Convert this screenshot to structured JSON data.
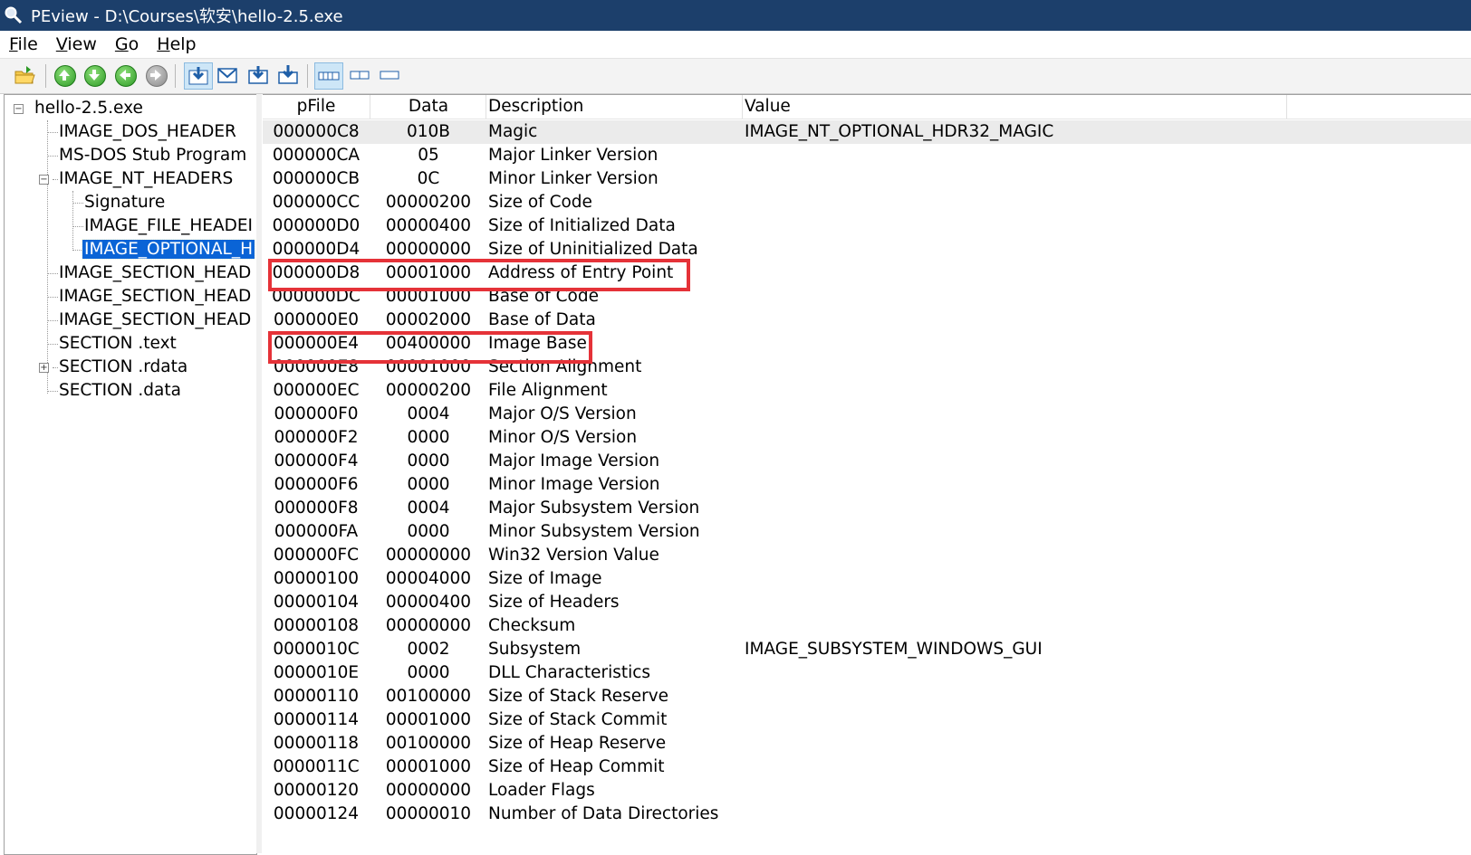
{
  "window": {
    "title": "PEview - D:\\Courses\\软安\\hello-2.5.exe"
  },
  "menu": {
    "items": [
      {
        "first": "F",
        "rest": "ile"
      },
      {
        "first": "V",
        "rest": "iew"
      },
      {
        "first": "G",
        "rest": "o"
      },
      {
        "first": "H",
        "rest": "elp"
      }
    ]
  },
  "toolbar": {
    "icons": [
      "open-folder-icon",
      "up-arrow-icon",
      "down-arrow-icon",
      "back-arrow-icon",
      "forward-arrow-icon",
      "view-download-icon",
      "view-mail-icon",
      "view-export-icon",
      "view-import-icon",
      "layout-full-icon",
      "layout-split-icon",
      "layout-minimal-icon"
    ],
    "accent": "#2c9a25"
  },
  "tree": {
    "root": "hello-2.5.exe",
    "items": [
      "IMAGE_DOS_HEADER",
      "MS-DOS Stub Program",
      "IMAGE_NT_HEADERS",
      "Signature",
      "IMAGE_FILE_HEADEI",
      "IMAGE_OPTIONAL_H",
      "IMAGE_SECTION_HEAD",
      "IMAGE_SECTION_HEAD",
      "IMAGE_SECTION_HEAD",
      "SECTION .text",
      "SECTION .rdata",
      "SECTION .data"
    ],
    "selected_color": "#0a64d6"
  },
  "list": {
    "columns": [
      "pFile",
      "Data",
      "Description",
      "Value"
    ],
    "rows": [
      [
        "000000C8",
        "010B",
        "Magic",
        "IMAGE_NT_OPTIONAL_HDR32_MAGIC"
      ],
      [
        "000000CA",
        "05",
        "Major Linker Version",
        ""
      ],
      [
        "000000CB",
        "0C",
        "Minor Linker Version",
        ""
      ],
      [
        "000000CC",
        "00000200",
        "Size of Code",
        ""
      ],
      [
        "000000D0",
        "00000400",
        "Size of Initialized Data",
        ""
      ],
      [
        "000000D4",
        "00000000",
        "Size of Uninitialized Data",
        ""
      ],
      [
        "000000D8",
        "00001000",
        "Address of Entry Point",
        ""
      ],
      [
        "000000DC",
        "00001000",
        "Base of Code",
        ""
      ],
      [
        "000000E0",
        "00002000",
        "Base of Data",
        ""
      ],
      [
        "000000E4",
        "00400000",
        "Image Base",
        ""
      ],
      [
        "000000E8",
        "00001000",
        "Section Alignment",
        ""
      ],
      [
        "000000EC",
        "00000200",
        "File Alignment",
        ""
      ],
      [
        "000000F0",
        "0004",
        "Major O/S Version",
        ""
      ],
      [
        "000000F2",
        "0000",
        "Minor O/S Version",
        ""
      ],
      [
        "000000F4",
        "0000",
        "Major Image Version",
        ""
      ],
      [
        "000000F6",
        "0000",
        "Minor Image Version",
        ""
      ],
      [
        "000000F8",
        "0004",
        "Major Subsystem Version",
        ""
      ],
      [
        "000000FA",
        "0000",
        "Minor Subsystem Version",
        ""
      ],
      [
        "000000FC",
        "00000000",
        "Win32 Version Value",
        ""
      ],
      [
        "00000100",
        "00004000",
        "Size of Image",
        ""
      ],
      [
        "00000104",
        "00000400",
        "Size of Headers",
        ""
      ],
      [
        "00000108",
        "00000000",
        "Checksum",
        ""
      ],
      [
        "0000010C",
        "0002",
        "Subsystem",
        "IMAGE_SUBSYSTEM_WINDOWS_GUI"
      ],
      [
        "0000010E",
        "0000",
        "DLL Characteristics",
        ""
      ],
      [
        "00000110",
        "00100000",
        "Size of Stack Reserve",
        ""
      ],
      [
        "00000114",
        "00001000",
        "Size of Stack Commit",
        ""
      ],
      [
        "00000118",
        "00100000",
        "Size of Heap Reserve",
        ""
      ],
      [
        "0000011C",
        "00001000",
        "Size of Heap Commit",
        ""
      ],
      [
        "00000120",
        "00000000",
        "Loader Flags",
        ""
      ],
      [
        "00000124",
        "00000010",
        "Number of Data Directories",
        ""
      ]
    ],
    "highlight_color": "#e53238",
    "highlighted_descriptions": [
      "Address of Entry Point",
      "Image Base"
    ]
  }
}
